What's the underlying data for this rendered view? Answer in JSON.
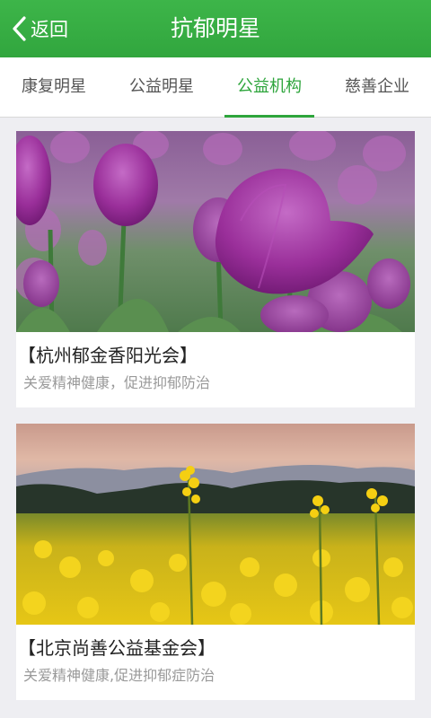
{
  "header": {
    "back_label": "返回",
    "title": "抗郁明星"
  },
  "tabs": [
    {
      "label": "康复明星",
      "active": false
    },
    {
      "label": "公益明星",
      "active": false
    },
    {
      "label": "公益机构",
      "active": true
    },
    {
      "label": "慈善企业",
      "active": false
    }
  ],
  "cards": [
    {
      "name": "【杭州郁金香阳光会】",
      "desc": "关爱精神健康，促进抑郁防治",
      "image": "purple-tulips-photo"
    },
    {
      "name": "【北京尚善公益基金会】",
      "desc": "关爱精神健康,促进抑郁症防治",
      "image": "rapeseed-flowers-photo"
    }
  ],
  "colors": {
    "accent": "#2ea53c",
    "header": "#37ae44",
    "background": "#eeeef2"
  }
}
